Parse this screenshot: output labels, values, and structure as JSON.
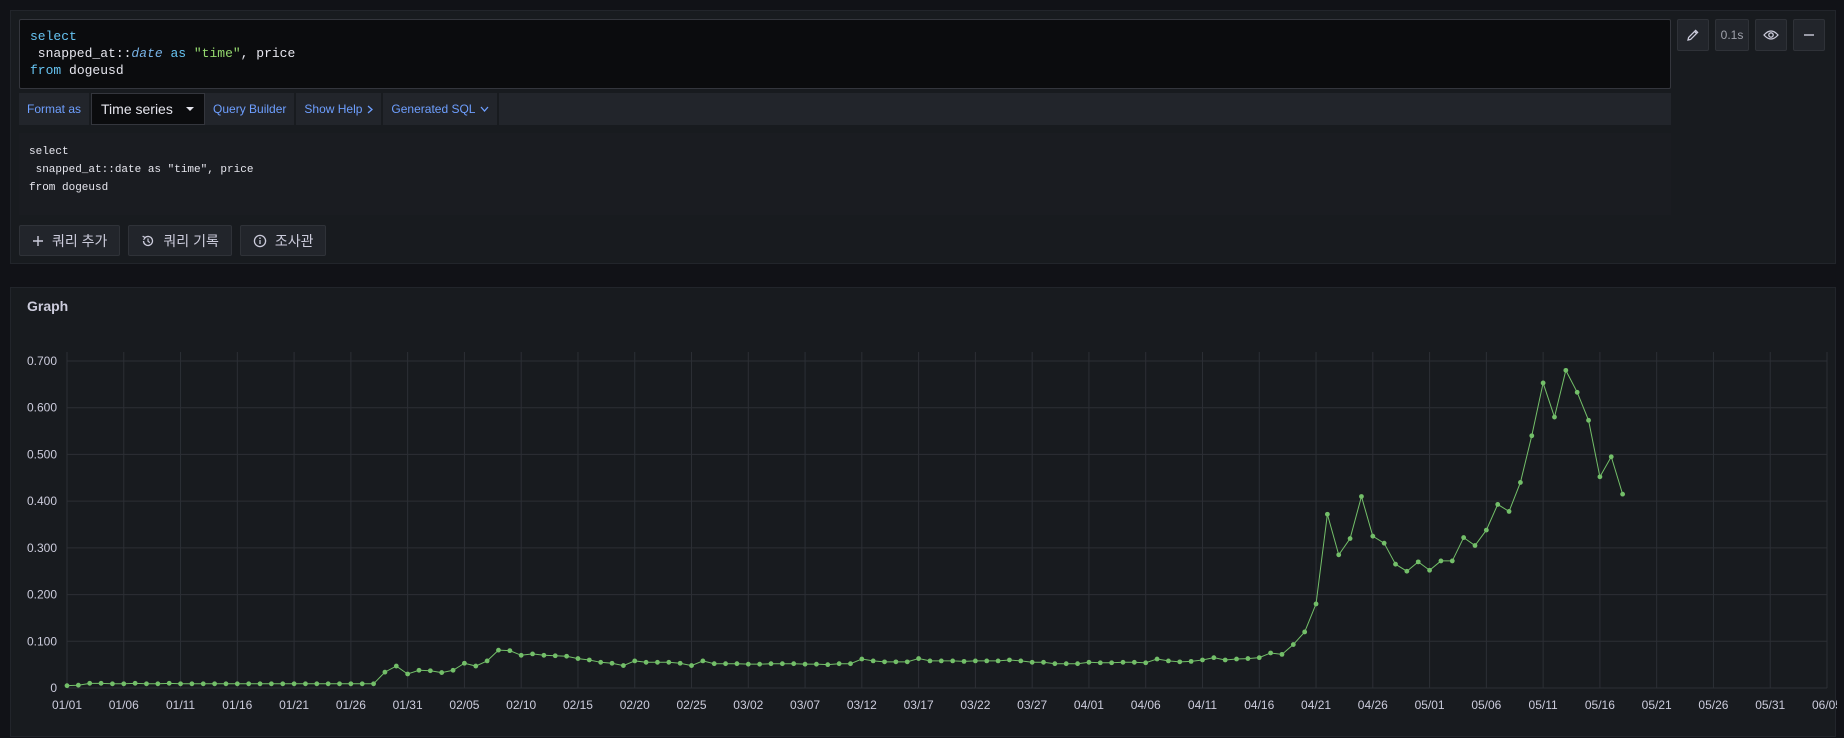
{
  "editor": {
    "l1_kw": "select",
    "l2_col": " snapped_at::",
    "l2_type": "date",
    "l2_as": " as ",
    "l2_str": "\"time\"",
    "l2_rest": ", price",
    "l3_kw": "from",
    "l3_rest": " dogeusd"
  },
  "side": {
    "duration": "0.1s"
  },
  "toolbar": {
    "format_as": "Format as",
    "format_value": "Time series",
    "query_builder": "Query Builder",
    "show_help": "Show Help",
    "generated_sql": "Generated SQL"
  },
  "sql_preview": "select\n snapped_at::date as \"time\", price\nfrom dogeusd",
  "actions": {
    "add_query": "쿼리 추가",
    "query_history": "쿼리 기록",
    "inspector": "조사관"
  },
  "graph": {
    "title": "Graph"
  },
  "colors": {
    "series": "#73bf69",
    "accent": "#6e9fff"
  },
  "chart_data": {
    "type": "line",
    "title": "Graph",
    "x_ticks": [
      "01/01",
      "01/06",
      "01/11",
      "01/16",
      "01/21",
      "01/26",
      "01/31",
      "02/05",
      "02/10",
      "02/15",
      "02/20",
      "02/25",
      "03/02",
      "03/07",
      "03/12",
      "03/17",
      "03/22",
      "03/27",
      "04/01",
      "04/06",
      "04/11",
      "04/16",
      "04/21",
      "04/26",
      "05/01",
      "05/06",
      "05/11",
      "05/16",
      "05/21",
      "05/26",
      "05/31",
      "06/05"
    ],
    "y_ticks": [
      "0",
      "0.100",
      "0.200",
      "0.300",
      "0.400",
      "0.500",
      "0.600",
      "0.700"
    ],
    "ylim": [
      0,
      0.7
    ],
    "x_days": [
      0,
      155
    ],
    "x_start": "01/01",
    "series": [
      {
        "values": [
          0.005,
          0.006,
          0.01,
          0.01,
          0.009,
          0.009,
          0.01,
          0.009,
          0.009,
          0.01,
          0.009,
          0.009,
          0.009,
          0.009,
          0.009,
          0.009,
          0.009,
          0.009,
          0.009,
          0.009,
          0.009,
          0.009,
          0.009,
          0.009,
          0.009,
          0.009,
          0.009,
          0.009,
          0.034,
          0.047,
          0.03,
          0.038,
          0.037,
          0.033,
          0.038,
          0.053,
          0.047,
          0.058,
          0.081,
          0.08,
          0.07,
          0.073,
          0.07,
          0.069,
          0.068,
          0.063,
          0.06,
          0.055,
          0.053,
          0.048,
          0.058,
          0.055,
          0.055,
          0.055,
          0.053,
          0.048,
          0.058,
          0.052,
          0.052,
          0.052,
          0.051,
          0.051,
          0.052,
          0.052,
          0.052,
          0.051,
          0.051,
          0.05,
          0.052,
          0.052,
          0.062,
          0.058,
          0.056,
          0.056,
          0.056,
          0.063,
          0.058,
          0.058,
          0.058,
          0.057,
          0.058,
          0.058,
          0.058,
          0.06,
          0.058,
          0.055,
          0.055,
          0.052,
          0.052,
          0.052,
          0.055,
          0.054,
          0.054,
          0.055,
          0.055,
          0.054,
          0.062,
          0.058,
          0.056,
          0.057,
          0.06,
          0.065,
          0.06,
          0.062,
          0.063,
          0.065,
          0.075,
          0.072,
          0.093,
          0.12,
          0.18,
          0.372,
          0.285,
          0.32,
          0.41,
          0.325,
          0.31,
          0.265,
          0.25,
          0.27,
          0.252,
          0.272,
          0.272,
          0.322,
          0.305,
          0.338,
          0.393,
          0.378,
          0.44,
          0.54,
          0.653,
          0.58,
          0.68,
          0.633,
          0.573,
          0.452,
          0.495,
          0.415
        ]
      }
    ]
  }
}
